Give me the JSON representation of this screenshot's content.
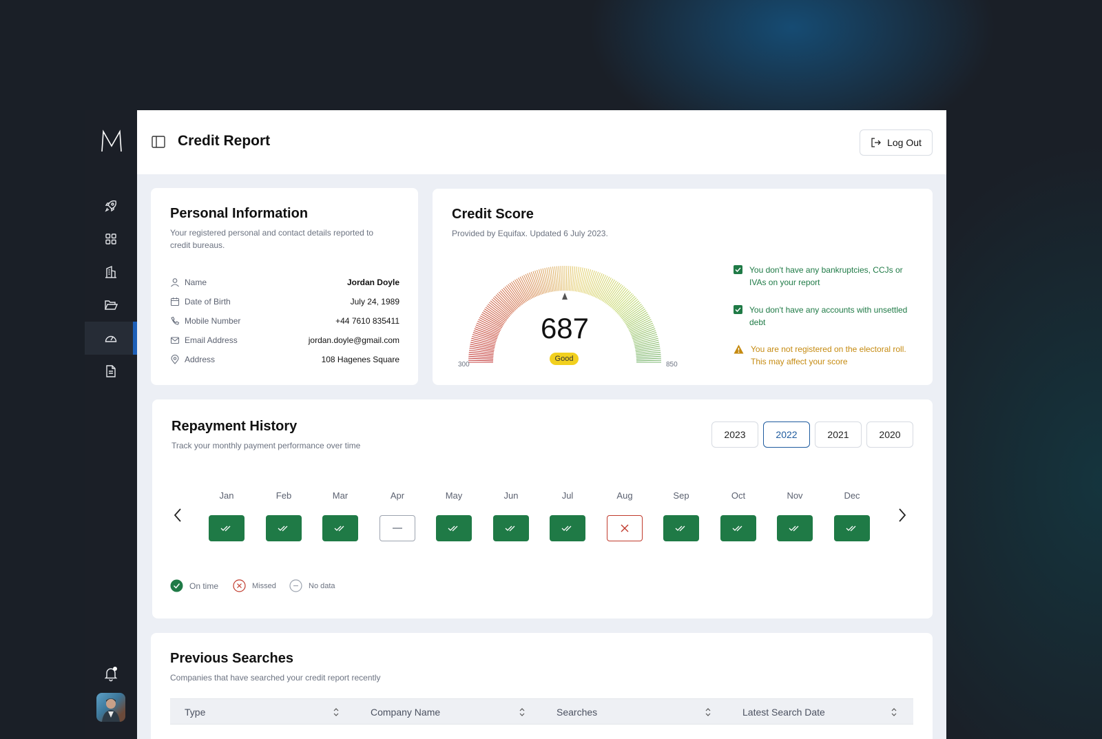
{
  "app": {
    "title": "Credit Report"
  },
  "topbar": {
    "logout_label": "Log Out"
  },
  "sidebar": {
    "items": [
      {
        "name": "rocket-icon"
      },
      {
        "name": "grid-icon"
      },
      {
        "name": "building-icon"
      },
      {
        "name": "folder-icon"
      },
      {
        "name": "gauge-icon",
        "active": true
      },
      {
        "name": "document-icon"
      }
    ]
  },
  "personal": {
    "title": "Personal Information",
    "subtitle": "Your registered personal and contact details reported to credit bureaus.",
    "rows": [
      {
        "label": "Name",
        "value": "Jordan Doyle",
        "icon": "user-icon"
      },
      {
        "label": "Date of Birth",
        "value": "July 24, 1989",
        "icon": "calendar-icon"
      },
      {
        "label": "Mobile Number",
        "value": "+44 7610 835411",
        "icon": "phone-icon"
      },
      {
        "label": "Email Address",
        "value": "jordan.doyle@gmail.com",
        "icon": "mail-icon"
      },
      {
        "label": "Address",
        "value": "108 Hagenes Square",
        "icon": "location-icon"
      }
    ]
  },
  "credit": {
    "title": "Credit Score",
    "subtitle": "Provided by Equifax. Updated 6 July 2023.",
    "score": "687",
    "rating": "Good",
    "min": "300",
    "max": "850",
    "score_value": 687,
    "checks": [
      {
        "text": "You don't have any bankruptcies, CCJs or IVAs on your report",
        "status": "ok",
        "color": "#1f7a46"
      },
      {
        "text": "You don't have any accounts with unsettled debt",
        "status": "ok",
        "color": "#1f7a46"
      },
      {
        "text": "You are not registered on the electoral roll. This may affect your score",
        "status": "warning",
        "color": "#c58a10"
      }
    ]
  },
  "repayment": {
    "title": "Repayment History",
    "subtitle": "Track your monthly payment performance over time",
    "years": [
      "2023",
      "2022",
      "2021",
      "2020"
    ],
    "selected_year": "2022",
    "months": [
      {
        "label": "Jan",
        "status": "on_time"
      },
      {
        "label": "Feb",
        "status": "on_time"
      },
      {
        "label": "Mar",
        "status": "on_time"
      },
      {
        "label": "Apr",
        "status": "no_data"
      },
      {
        "label": "May",
        "status": "on_time"
      },
      {
        "label": "Jun",
        "status": "on_time"
      },
      {
        "label": "Jul",
        "status": "on_time"
      },
      {
        "label": "Aug",
        "status": "missed"
      },
      {
        "label": "Sep",
        "status": "on_time"
      },
      {
        "label": "Oct",
        "status": "on_time"
      },
      {
        "label": "Nov",
        "status": "on_time"
      },
      {
        "label": "Dec",
        "status": "on_time"
      }
    ],
    "legend": {
      "on_time": "On time",
      "missed": "Missed",
      "no_data": "No data"
    },
    "colors": {
      "on_time": "#1f7a46",
      "missed": "#c0392b",
      "no_data": "#9ca3af"
    }
  },
  "searches": {
    "title": "Previous Searches",
    "subtitle": "Companies that have searched your credit report recently",
    "columns": [
      "Type",
      "Company Name",
      "Searches",
      "Latest Search Date"
    ]
  }
}
